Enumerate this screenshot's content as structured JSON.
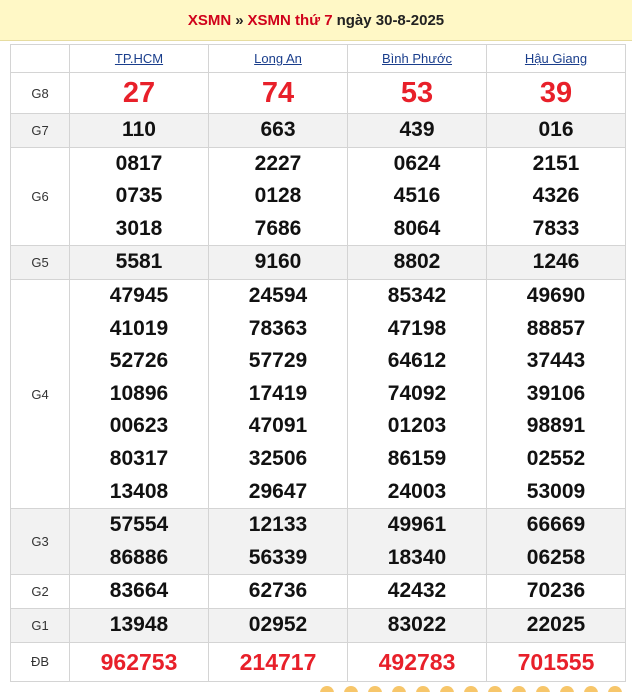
{
  "header": {
    "link1": "XSMN",
    "separator": "»",
    "link2": "XSMN thứ 7",
    "date_text": "ngày 30-8-2025"
  },
  "provinces": [
    "TP.HCM",
    "Long An",
    "Bình Phước",
    "Hậu Giang"
  ],
  "prizes": [
    {
      "label": "G8",
      "values": [
        [
          "27"
        ],
        [
          "74"
        ],
        [
          "53"
        ],
        [
          "39"
        ]
      ]
    },
    {
      "label": "G7",
      "values": [
        [
          "110"
        ],
        [
          "663"
        ],
        [
          "439"
        ],
        [
          "016"
        ]
      ]
    },
    {
      "label": "G6",
      "values": [
        [
          "0817",
          "0735",
          "3018"
        ],
        [
          "2227",
          "0128",
          "7686"
        ],
        [
          "0624",
          "4516",
          "8064"
        ],
        [
          "2151",
          "4326",
          "7833"
        ]
      ]
    },
    {
      "label": "G5",
      "values": [
        [
          "5581"
        ],
        [
          "9160"
        ],
        [
          "8802"
        ],
        [
          "1246"
        ]
      ]
    },
    {
      "label": "G4",
      "values": [
        [
          "47945",
          "41019",
          "52726",
          "10896",
          "00623",
          "80317",
          "13408"
        ],
        [
          "24594",
          "78363",
          "57729",
          "17419",
          "47091",
          "32506",
          "29647"
        ],
        [
          "85342",
          "47198",
          "64612",
          "74092",
          "01203",
          "86159",
          "24003"
        ],
        [
          "49690",
          "88857",
          "37443",
          "39106",
          "98891",
          "02552",
          "53009"
        ]
      ]
    },
    {
      "label": "G3",
      "values": [
        [
          "57554",
          "86886"
        ],
        [
          "12133",
          "56339"
        ],
        [
          "49961",
          "18340"
        ],
        [
          "66669",
          "06258"
        ]
      ]
    },
    {
      "label": "G2",
      "values": [
        [
          "83664"
        ],
        [
          "62736"
        ],
        [
          "42432"
        ],
        [
          "70236"
        ]
      ]
    },
    {
      "label": "G1",
      "values": [
        [
          "13948"
        ],
        [
          "02952"
        ],
        [
          "83022"
        ],
        [
          "22025"
        ]
      ]
    },
    {
      "label": "ĐB",
      "values": [
        [
          "962753"
        ],
        [
          "214717"
        ],
        [
          "492783"
        ],
        [
          "701555"
        ]
      ]
    }
  ],
  "colors": {
    "header_bg": "#fff8c6",
    "link_red": "#d0021b",
    "province_blue": "#1a3e8c",
    "special_red": "#e8202a",
    "alt_row_bg": "#f2f2f2"
  }
}
